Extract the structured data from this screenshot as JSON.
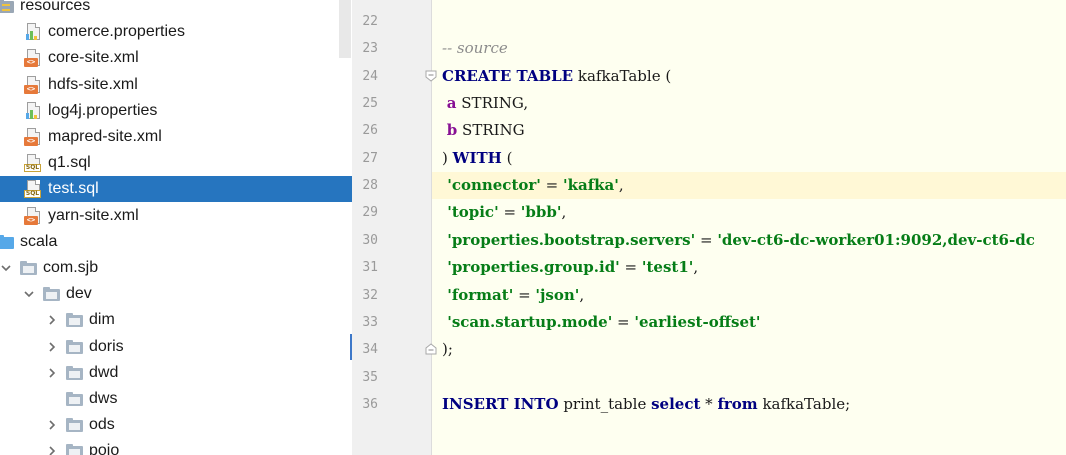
{
  "tree": {
    "items": [
      {
        "label": "resources",
        "icon": "resources-folder-icon",
        "arrow": "none",
        "indent": 0,
        "selected": false
      },
      {
        "label": "comerce.properties",
        "icon": "properties-file-icon",
        "arrow": "none",
        "indent": 1,
        "selected": false
      },
      {
        "label": "core-site.xml",
        "icon": "xml-file-icon",
        "arrow": "none",
        "indent": 1,
        "selected": false
      },
      {
        "label": "hdfs-site.xml",
        "icon": "xml-file-icon",
        "arrow": "none",
        "indent": 1,
        "selected": false
      },
      {
        "label": "log4j.properties",
        "icon": "properties-file-icon",
        "arrow": "none",
        "indent": 1,
        "selected": false
      },
      {
        "label": "mapred-site.xml",
        "icon": "xml-file-icon",
        "arrow": "none",
        "indent": 1,
        "selected": false
      },
      {
        "label": "q1.sql",
        "icon": "sql-file-icon",
        "arrow": "none",
        "indent": 1,
        "selected": false
      },
      {
        "label": "test.sql",
        "icon": "sql-file-icon",
        "arrow": "none",
        "indent": 1,
        "selected": true
      },
      {
        "label": "yarn-site.xml",
        "icon": "xml-file-icon",
        "arrow": "none",
        "indent": 1,
        "selected": false
      },
      {
        "label": "scala",
        "icon": "source-folder-icon",
        "arrow": "none",
        "indent": 0,
        "selected": false
      },
      {
        "label": "com.sjb",
        "icon": "package-folder-icon",
        "arrow": "down",
        "indent": 0,
        "selected": false
      },
      {
        "label": "dev",
        "icon": "package-folder-icon",
        "arrow": "down",
        "indent": 1,
        "selected": false
      },
      {
        "label": "dim",
        "icon": "package-folder-icon",
        "arrow": "right",
        "indent": 2,
        "selected": false
      },
      {
        "label": "doris",
        "icon": "package-folder-icon",
        "arrow": "right",
        "indent": 2,
        "selected": false
      },
      {
        "label": "dwd",
        "icon": "package-folder-icon",
        "arrow": "right",
        "indent": 2,
        "selected": false
      },
      {
        "label": "dws",
        "icon": "package-folder-icon",
        "arrow": "none",
        "indent": 2,
        "selected": false
      },
      {
        "label": "ods",
        "icon": "package-folder-icon",
        "arrow": "right",
        "indent": 2,
        "selected": false
      },
      {
        "label": "pojo",
        "icon": "package-folder-icon",
        "arrow": "right",
        "indent": 2,
        "selected": false
      }
    ]
  },
  "editor": {
    "current_line": 28,
    "fold_lines": [
      24,
      34
    ],
    "lines": [
      {
        "num": "22",
        "tokens": []
      },
      {
        "num": "23",
        "tokens": [
          {
            "t": "-- source",
            "c": "cmt"
          }
        ]
      },
      {
        "num": "24",
        "tokens": [
          {
            "t": "CREATE TABLE",
            "c": "kw"
          },
          {
            "t": " kafkaTable (",
            "c": "pct"
          }
        ]
      },
      {
        "num": "25",
        "tokens": [
          {
            "t": " ",
            "c": "pct"
          },
          {
            "t": "a",
            "c": "col"
          },
          {
            "t": " STRING,",
            "c": "pct"
          }
        ]
      },
      {
        "num": "26",
        "tokens": [
          {
            "t": " ",
            "c": "pct"
          },
          {
            "t": "b",
            "c": "col"
          },
          {
            "t": " STRING",
            "c": "pct"
          }
        ]
      },
      {
        "num": "27",
        "tokens": [
          {
            "t": ") ",
            "c": "pct"
          },
          {
            "t": "WITH",
            "c": "kw"
          },
          {
            "t": " (",
            "c": "pct"
          }
        ]
      },
      {
        "num": "28",
        "tokens": [
          {
            "t": " 'connector'",
            "c": "str"
          },
          {
            "t": " = ",
            "c": "pct"
          },
          {
            "t": "'kafka'",
            "c": "str"
          },
          {
            "t": ",",
            "c": "pct"
          }
        ]
      },
      {
        "num": "29",
        "tokens": [
          {
            "t": " 'topic'",
            "c": "str"
          },
          {
            "t": " = ",
            "c": "pct"
          },
          {
            "t": "'bbb'",
            "c": "str"
          },
          {
            "t": ",",
            "c": "pct"
          }
        ]
      },
      {
        "num": "30",
        "tokens": [
          {
            "t": " 'properties.bootstrap.servers'",
            "c": "str"
          },
          {
            "t": " = ",
            "c": "pct"
          },
          {
            "t": "'dev-ct6-dc-worker01:9092,dev-ct6-dc",
            "c": "str"
          }
        ]
      },
      {
        "num": "31",
        "tokens": [
          {
            "t": " 'properties.group.id'",
            "c": "str"
          },
          {
            "t": " = ",
            "c": "pct"
          },
          {
            "t": "'test1'",
            "c": "str"
          },
          {
            "t": ",",
            "c": "pct"
          }
        ]
      },
      {
        "num": "32",
        "tokens": [
          {
            "t": " 'format'",
            "c": "str"
          },
          {
            "t": " = ",
            "c": "pct"
          },
          {
            "t": "'json'",
            "c": "str"
          },
          {
            "t": ",",
            "c": "pct"
          }
        ]
      },
      {
        "num": "33",
        "tokens": [
          {
            "t": " 'scan.startup.mode'",
            "c": "str"
          },
          {
            "t": " = ",
            "c": "pct"
          },
          {
            "t": "'earliest-offset'",
            "c": "str"
          }
        ]
      },
      {
        "num": "34",
        "tokens": [
          {
            "t": ");",
            "c": "pct"
          }
        ]
      },
      {
        "num": "35",
        "tokens": []
      },
      {
        "num": "36",
        "tokens": [
          {
            "t": "INSERT INTO",
            "c": "kw"
          },
          {
            "t": " print_table ",
            "c": "pct"
          },
          {
            "t": "select",
            "c": "kw"
          },
          {
            "t": " * ",
            "c": "pct"
          },
          {
            "t": "from",
            "c": "kw"
          },
          {
            "t": " kafkaTable;",
            "c": "pct"
          }
        ]
      }
    ]
  }
}
